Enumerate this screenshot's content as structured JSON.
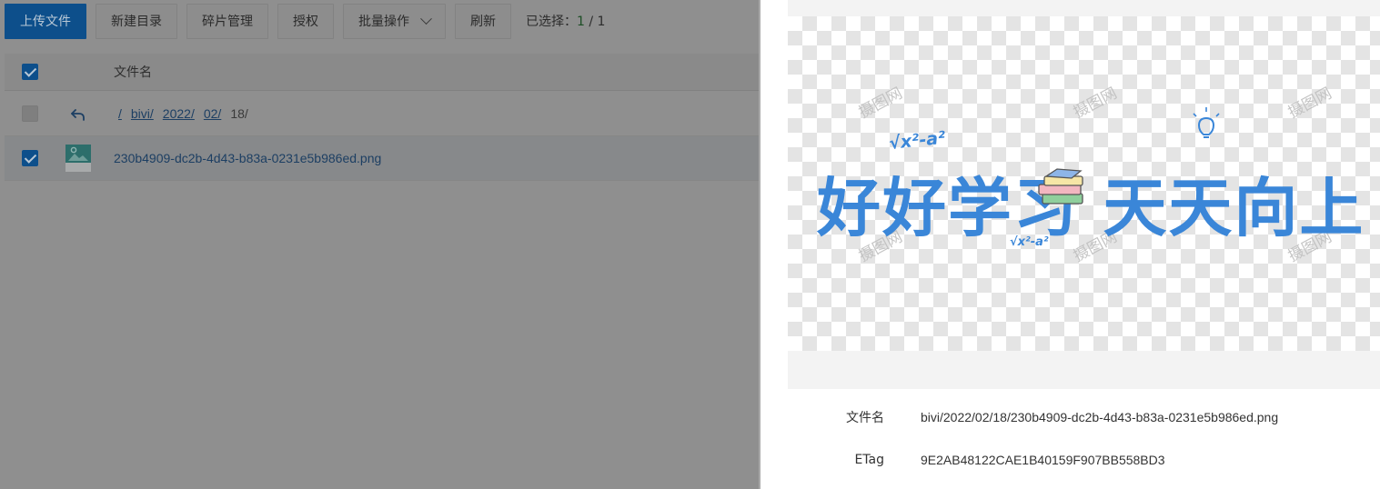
{
  "toolbar": {
    "upload": "上传文件",
    "new_dir": "新建目录",
    "fragments": "碎片管理",
    "authorize": "授权",
    "batch": "批量操作",
    "refresh": "刷新",
    "selected_label": "已选择：",
    "selected_count": "1",
    "selected_sep": " / ",
    "selected_total": "1"
  },
  "table": {
    "header_name": "文件名",
    "breadcrumb": [
      "/",
      "bivi/",
      "2022/",
      "02/"
    ],
    "breadcrumb_current": "18/",
    "rows": [
      {
        "name": "230b4909-dc2b-4d43-b83a-0231e5b986ed.png",
        "checked": true
      }
    ]
  },
  "preview": {
    "artwork_text": "好好学习 天天向上",
    "formula": "√x²-a²",
    "watermark": "摄图网"
  },
  "details": {
    "filename_label": "文件名",
    "filename_value": "bivi/2022/02/18/230b4909-dc2b-4d43-b83a-0231e5b986ed.png",
    "etag_label": "ETag",
    "etag_value": "9E2AB48122CAE1B40159F907BB558BD3"
  },
  "colors": {
    "primary": "#0d4f8b",
    "mask": "#8f8f8f",
    "art_blue": "#3a86d8"
  }
}
